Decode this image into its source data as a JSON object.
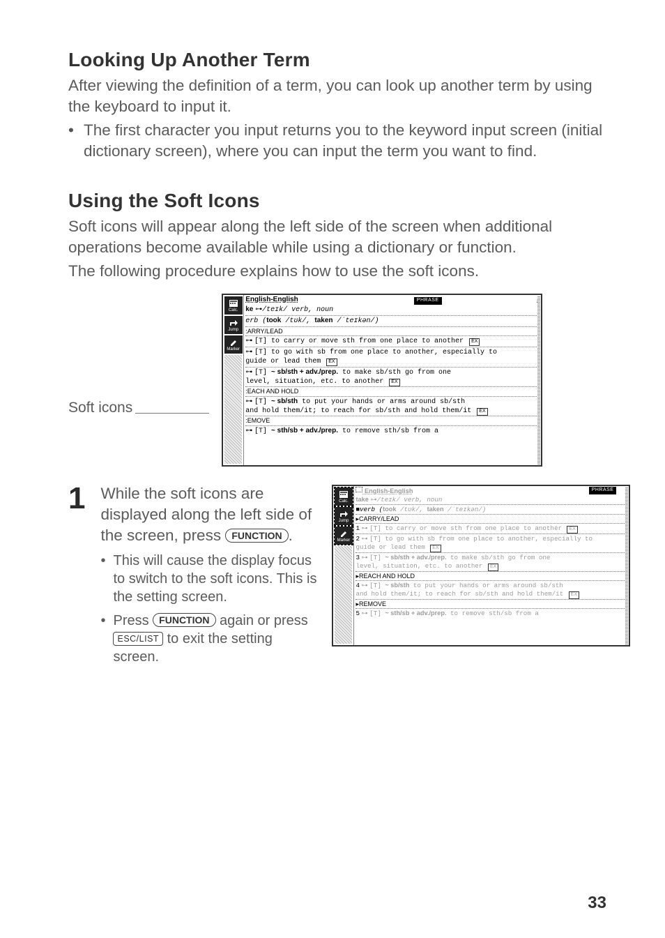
{
  "section1": {
    "heading": "Looking Up Another Term",
    "p1": "After viewing the definition of a term, you can look up another term by using the keyboard to input it.",
    "b1": "The first character you input returns you to the keyword input screen (initial dictionary screen), where you can input the term you want to find."
  },
  "section2": {
    "heading": "Using the Soft Icons",
    "p1": "Soft icons will appear along the left side of the screen when additional operations become available while using a dictionary or function.",
    "p2": "The following procedure explains how to use the soft icons."
  },
  "fig1": {
    "label": "Soft icons",
    "icons": {
      "calc": "Calc.",
      "jump": "Jump",
      "marker": "Marker"
    },
    "dictTitle": "English-English",
    "badge": "PHRASE",
    "headword": "ke ",
    "ipa1": "/teɪk/",
    "partOfSpeech": " verb, noun",
    "forms_pre": "erb (",
    "forms_took": "took",
    "forms_took_ipa": " /tʊk/, ",
    "forms_taken": "taken",
    "forms_taken_ipa": " /ˈteɪkən/)",
    "sense_carry": ":ARRY/LEAD",
    "def1": "[T] to carry or move sth from one place to another",
    "def2": "[T] to go with sb from one place to another, especially to",
    "def2b": "guide or lead them",
    "def3a": "[T] ",
    "def3pattern": "~ sb/sth + adv./prep.",
    "def3b": " to make sb/sth go from one",
    "def3c": "level, situation, etc. to another",
    "sense_reach": ":EACH AND HOLD",
    "def4a": "[T] ",
    "def4pattern": "~ sb/sth",
    "def4b": " to put your hands or arms around sb/sth",
    "def4c": "and hold them/it; to reach for sb/sth and hold them/it",
    "sense_remove": ":EMOVE",
    "def5a": "[T] ",
    "def5pattern": "~ sth/sb + adv./prep.",
    "def5b": " to remove sth/sb from a",
    "ex": "EX"
  },
  "step1": {
    "num": "1",
    "para_a": "While the soft icons are displayed along the left side of the screen, press ",
    "key_function": "FUNCTION",
    "para_b": ".",
    "sub1": "This will cause the display focus to switch to the soft icons. This is the setting screen.",
    "sub2a": "Press ",
    "sub2b": " again or press ",
    "key_esclist": "ESC/LIST",
    "sub2c": " to exit the setting screen."
  },
  "fig2": {
    "dictTitle": " English-English",
    "headword": "take ",
    "ipa1": "/teɪk/",
    "partOfSpeech": " verb, noun",
    "forms_pre": "■verb (",
    "forms_took": "took",
    "forms_took_ipa": " /tʊk/, ",
    "forms_taken": "taken",
    "forms_taken_ipa": " /ˈteɪkən/)",
    "sense_carry": "▸CARRY/LEAD",
    "def1": "[T] to carry or move sth from one place to another",
    "def2": "[T] to go with sb from one place to another, especially to",
    "def2b": "guide or lead them",
    "def3a": "[T] ",
    "def3pattern": "~ sb/sth + adv./prep.",
    "def3b": " to make sb/sth go from one",
    "def3c": "level, situation, etc. to another",
    "sense_reach": "▸REACH AND HOLD",
    "def4a": "[T] ",
    "def4pattern": "~ sb/sth",
    "def4b": " to put your hands or arms around sb/sth",
    "def4c": "and hold them/it; to reach for sb/sth and hold them/it",
    "sense_remove": "▸REMOVE",
    "def5a": "[T] ",
    "def5pattern": "~ sth/sb + adv./prep.",
    "def5b": " to remove sth/sb from a",
    "n1": "1",
    "n2": "2",
    "n3": "3",
    "n4": "4",
    "n5": "5"
  },
  "pageNumber": "33"
}
